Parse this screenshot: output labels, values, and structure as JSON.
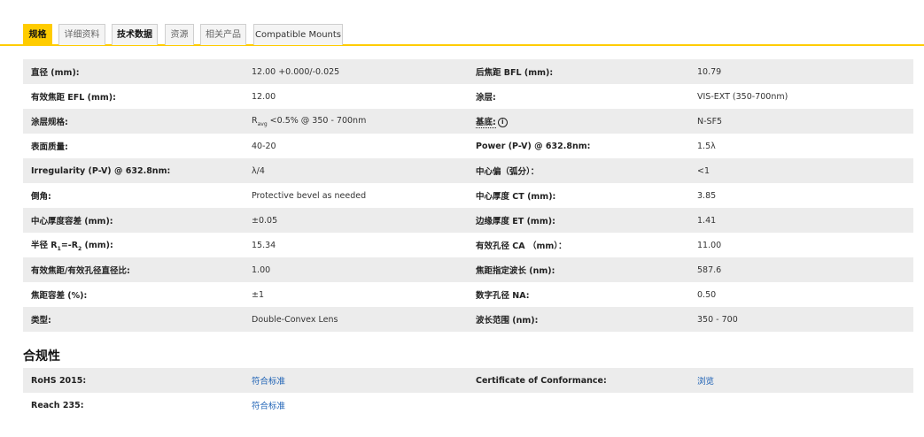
{
  "tabs": [
    {
      "label": "规格",
      "active": true
    },
    {
      "label": "详细资料",
      "active": false
    },
    {
      "label": "技术数据",
      "active": false
    },
    {
      "label": "资源",
      "active": false
    },
    {
      "label": "相关产品",
      "active": false
    },
    {
      "label": "Compatible Mounts",
      "active": false
    }
  ],
  "specs": {
    "rows": [
      {
        "l1": "直径 (mm):",
        "v1": "12.00 +0.000/-0.025",
        "l2": "后焦距 BFL (mm):",
        "v2": "10.79"
      },
      {
        "l1": "有效焦距 EFL (mm):",
        "v1": "12.00",
        "l2": "涂层:",
        "v2": "VIS-EXT (350-700nm)"
      },
      {
        "l1": "涂层规格:",
        "v1_r": "R",
        "v1_sub": "avg",
        "v1_rest": " <0.5% @ 350 - 700nm",
        "l2": "基底:",
        "l2_icon": "i",
        "v2": "N-SF5"
      },
      {
        "l1": "表面质量:",
        "v1": "40-20",
        "l2": "Power (P-V) @ 632.8nm:",
        "v2": "1.5λ"
      },
      {
        "l1": "Irregularity (P-V) @ 632.8nm:",
        "v1": "λ/4",
        "l2": "中心偏（弧分）：",
        "v2": "<1"
      },
      {
        "l1": "倒角:",
        "v1": "Protective bevel as needed",
        "l2": "中心厚度 CT (mm):",
        "v2": "3.85"
      },
      {
        "l1": "中心厚度容差 (mm):",
        "v1": "±0.05",
        "l2": "边缘厚度 ET (mm):",
        "v2": "1.41"
      },
      {
        "l1_a": "半径 R",
        "l1_sub1": "1",
        "l1_b": "=-R",
        "l1_sub2": "2",
        "l1_c": " (mm):",
        "v1": "15.34",
        "l2": "有效孔径 CA （mm）：",
        "v2": "11.00"
      },
      {
        "l1": "有效焦距/有效孔径直径比:",
        "v1": "1.00",
        "l2": "焦距指定波长 (nm):",
        "v2": "587.6"
      },
      {
        "l1": "焦距容差 (%):",
        "v1": "±1",
        "l2": "数字孔径 NA:",
        "v2": "0.50"
      },
      {
        "l1": "类型:",
        "v1": "Double-Convex Lens",
        "l2": "波长范围 (nm):",
        "v2": "350 - 700"
      }
    ]
  },
  "compliance": {
    "title": "合规性",
    "rows": [
      {
        "l1": "RoHS 2015:",
        "v1": "符合标准",
        "l2": "Certificate of Conformance:",
        "v2": "浏览"
      },
      {
        "l1": "Reach 235:",
        "v1": "符合标准",
        "l2": "",
        "v2": ""
      }
    ]
  },
  "colors": {
    "accent": "#ffcc00",
    "link": "#1a5fb4",
    "row_shade": "#ececec"
  }
}
